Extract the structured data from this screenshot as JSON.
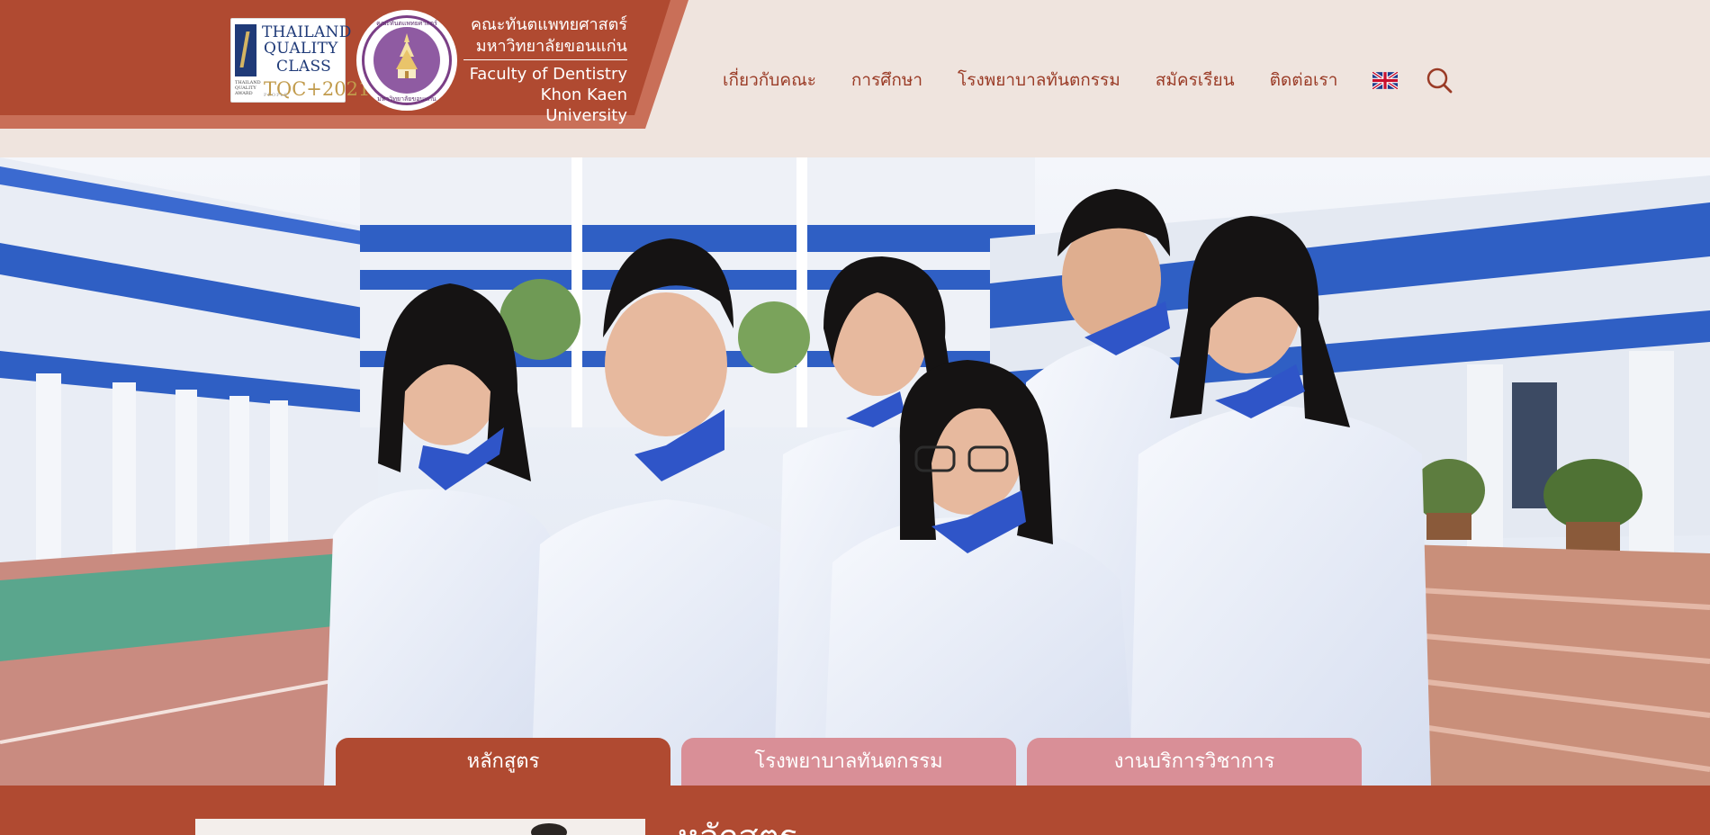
{
  "header": {
    "quality_badge": {
      "line1": "THAILAND",
      "line2": "QUALITY",
      "line3": "CLASS",
      "small_text": "THAILAND QUALITY AWARD",
      "year": "TQC+2021",
      "sub": "PEOPLE"
    },
    "seal": {
      "top_text": "คณะทันตแพทยศาสตร์",
      "bottom_text": "มหาวิทยาลัยขอนแก่น"
    },
    "faculty": {
      "thai_line1": "คณะทันตแพทยศาสตร์",
      "thai_line2": "มหาวิทยาลัยขอนแก่น",
      "english_line1": "Faculty of Dentistry",
      "english_line2": "Khon Kaen University"
    },
    "nav": {
      "items": [
        {
          "label": "เกี่ยวกับคณะ"
        },
        {
          "label": "การศึกษา"
        },
        {
          "label": "โรงพยาบาลทันตกรรม"
        },
        {
          "label": "สมัครเรียน"
        },
        {
          "label": "ติดต่อเรา"
        }
      ],
      "language_icon": "uk-flag-icon",
      "search_icon": "search-icon"
    },
    "colors": {
      "brand": "#b04a31",
      "brand_shadow": "#c96f58",
      "background": "#efe4de",
      "nav_text": "#9a3b26"
    }
  },
  "hero": {
    "tabs": [
      {
        "label": "หลักสูตร",
        "active": true
      },
      {
        "label": "โรงพยาบาลทันตกรรม",
        "active": false
      },
      {
        "label": "งานบริการวิชาการ",
        "active": false
      }
    ],
    "colors": {
      "active_tab": "#b04a31",
      "inactive_tab": "#d98f97"
    }
  },
  "section": {
    "title": "หลักสูตร"
  }
}
